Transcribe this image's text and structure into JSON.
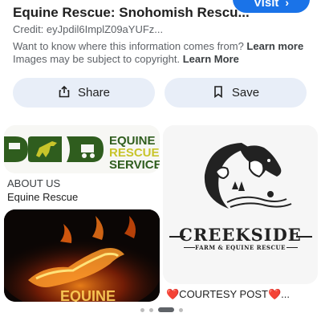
{
  "header": {
    "title": "Equine Rescue: Snohomish Rescu...",
    "visit_label": "Visit",
    "credit": "Credit: eyJpdil6ImplZ09aYUFz...",
    "info_text_1": "Want to know where this information comes from?",
    "info_link_1": "Learn more",
    "info_text_2": "Images may be subject to copyright.",
    "info_link_2": "Learn More"
  },
  "actions": {
    "share_label": "Share",
    "save_label": "Save"
  },
  "results": {
    "left_logo": {
      "lines": [
        "EQUINE",
        "RESCUE",
        "SERVICES"
      ]
    },
    "left_source": "ABOUT US",
    "left_title": "Equine Rescue",
    "fire_text": "EQUINE",
    "right_logo": {
      "name": "CREEKSIDE",
      "tagline": "FARM & EQUINE RESCUE"
    },
    "right_title": "❤️COURTESY POST❤️..."
  },
  "pager": {
    "count": 4,
    "active_index": 2
  },
  "colors": {
    "visit_button": "#1a73e8",
    "action_button_bg": "#e8eef8",
    "logo_green": "#2f5d1e",
    "logo_yellow": "#c8c42a"
  }
}
